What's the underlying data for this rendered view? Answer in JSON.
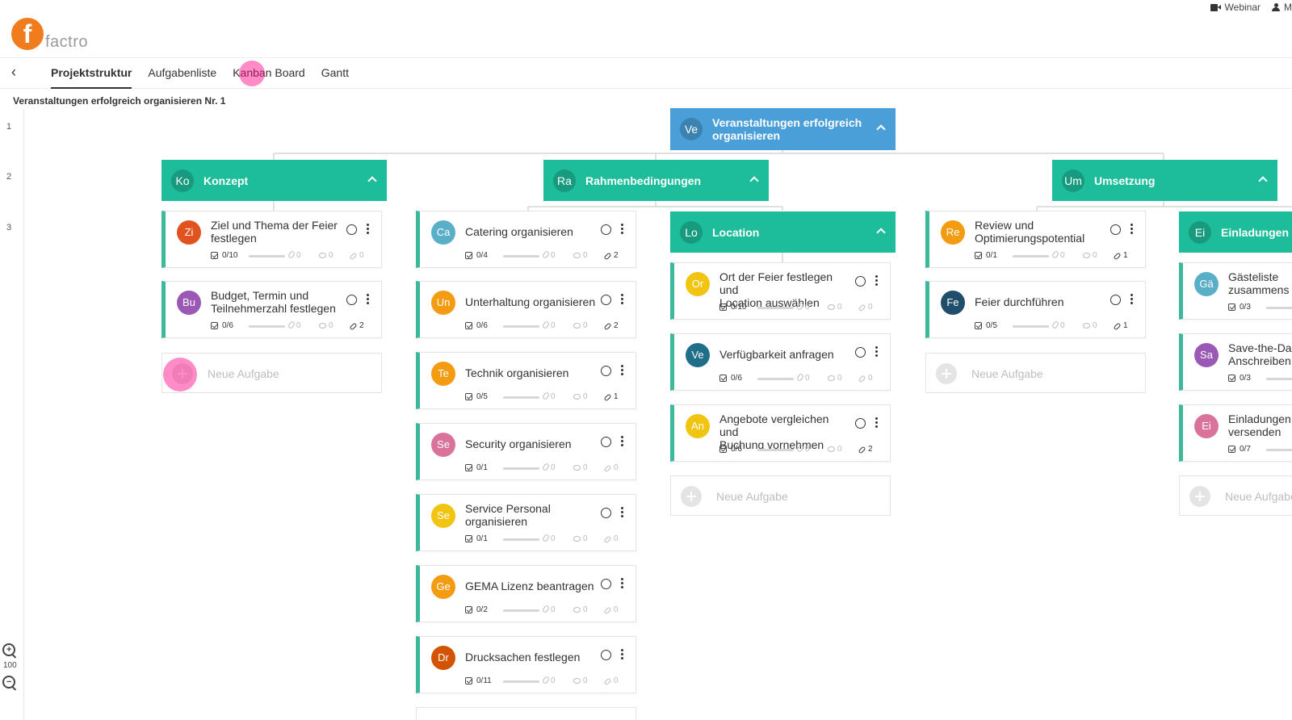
{
  "header": {
    "logo_letter": "f",
    "logo_text": "factro",
    "webinar_label": "Webinar",
    "user_label": "M"
  },
  "tabs": [
    {
      "label": "Projektstruktur",
      "active": true
    },
    {
      "label": "Aufgabenliste",
      "active": false
    },
    {
      "label": "Kanban Board",
      "active": false
    },
    {
      "label": "Gantt",
      "active": false
    }
  ],
  "project_title": "Veranstaltungen erfolgreich organisieren Nr. 1",
  "levels": [
    "1",
    "2",
    "3"
  ],
  "zoom": {
    "level": "100"
  },
  "root": {
    "abbr": "Ve",
    "title_line1": "Veranstaltungen erfolgreich",
    "title_line2": "organisieren",
    "color": "#4a9fd8"
  },
  "packages": [
    {
      "abbr": "Ko",
      "title": "Konzept"
    },
    {
      "abbr": "Ra",
      "title": "Rahmenbedingungen"
    },
    {
      "abbr": "Um",
      "title": "Umsetzung"
    }
  ],
  "subpackages": [
    {
      "abbr": "Lo",
      "title": "Location"
    },
    {
      "abbr": "Ei",
      "title": "Einladungen"
    }
  ],
  "new_task_label": "Neue Aufgabe",
  "columns": {
    "konzept": [
      {
        "abbr": "Zi",
        "line1": "Ziel und Thema der Feier",
        "line2": "festlegen",
        "sub": "0/10",
        "attach": "0",
        "comments": "0",
        "links": "0",
        "color": "#e0531f"
      },
      {
        "abbr": "Bu",
        "line1": "Budget, Termin und",
        "line2": "Teilnehmerzahl festlegen",
        "sub": "0/6",
        "attach": "0",
        "comments": "0",
        "links": "2",
        "color": "#9b59b6"
      }
    ],
    "rahmen": [
      {
        "abbr": "Ca",
        "line1": "Catering organisieren",
        "line2": "",
        "sub": "0/4",
        "attach": "0",
        "comments": "0",
        "links": "2",
        "color": "#5aafc8"
      },
      {
        "abbr": "Un",
        "line1": "Unterhaltung organisieren",
        "line2": "",
        "sub": "0/6",
        "attach": "0",
        "comments": "0",
        "links": "2",
        "color": "#f39c12"
      },
      {
        "abbr": "Te",
        "line1": "Technik organisieren",
        "line2": "",
        "sub": "0/5",
        "attach": "0",
        "comments": "0",
        "links": "1",
        "color": "#f39c12"
      },
      {
        "abbr": "Se",
        "line1": "Security organisieren",
        "line2": "",
        "sub": "0/1",
        "attach": "0",
        "comments": "0",
        "links": "0",
        "color": "#d9739b"
      },
      {
        "abbr": "Se",
        "line1": "Service Personal",
        "line2": "organisieren",
        "sub": "0/1",
        "attach": "0",
        "comments": "0",
        "links": "0",
        "color": "#f1c40f"
      },
      {
        "abbr": "Ge",
        "line1": "GEMA Lizenz beantragen",
        "line2": "",
        "sub": "0/2",
        "attach": "0",
        "comments": "0",
        "links": "0",
        "color": "#f39c12"
      },
      {
        "abbr": "Dr",
        "line1": "Drucksachen festlegen",
        "line2": "",
        "sub": "0/11",
        "attach": "0",
        "comments": "0",
        "links": "0",
        "color": "#d35400"
      }
    ],
    "location": [
      {
        "abbr": "Or",
        "line1": "Ort der Feier festlegen und",
        "line2": "Location auswählen",
        "sub": "0/10",
        "attach": "0",
        "comments": "0",
        "links": "0",
        "color": "#f1c40f"
      },
      {
        "abbr": "Ve",
        "line1": "Verfügbarkeit anfragen",
        "line2": "",
        "sub": "0/6",
        "attach": "0",
        "comments": "0",
        "links": "0",
        "color": "#1f6f8b"
      },
      {
        "abbr": "An",
        "line1": "Angebote vergleichen und",
        "line2": "Buchung vornehmen",
        "sub": "0/6",
        "attach": "0",
        "comments": "0",
        "links": "2",
        "color": "#f1c40f"
      }
    ],
    "umsetzung": [
      {
        "abbr": "Re",
        "line1": "Review und",
        "line2": "Optimierungspotential",
        "sub": "0/1",
        "attach": "0",
        "comments": "0",
        "links": "1",
        "color": "#f39c12"
      },
      {
        "abbr": "Fe",
        "line1": "Feier durchführen",
        "line2": "",
        "sub": "0/5",
        "attach": "0",
        "comments": "0",
        "links": "1",
        "color": "#1f4e6b"
      }
    ],
    "einladungen": [
      {
        "abbr": "Gä",
        "line1": "Gästeliste",
        "line2": "zusammens",
        "sub": "0/3",
        "color": "#5aafc8"
      },
      {
        "abbr": "Sa",
        "line1": "Save-the-Da",
        "line2": "Anschreiben",
        "sub": "0/3",
        "color": "#9b59b6"
      },
      {
        "abbr": "Ei",
        "line1": "Einladungen",
        "line2": "versenden",
        "sub": "0/7",
        "color": "#d9739b"
      }
    ]
  }
}
